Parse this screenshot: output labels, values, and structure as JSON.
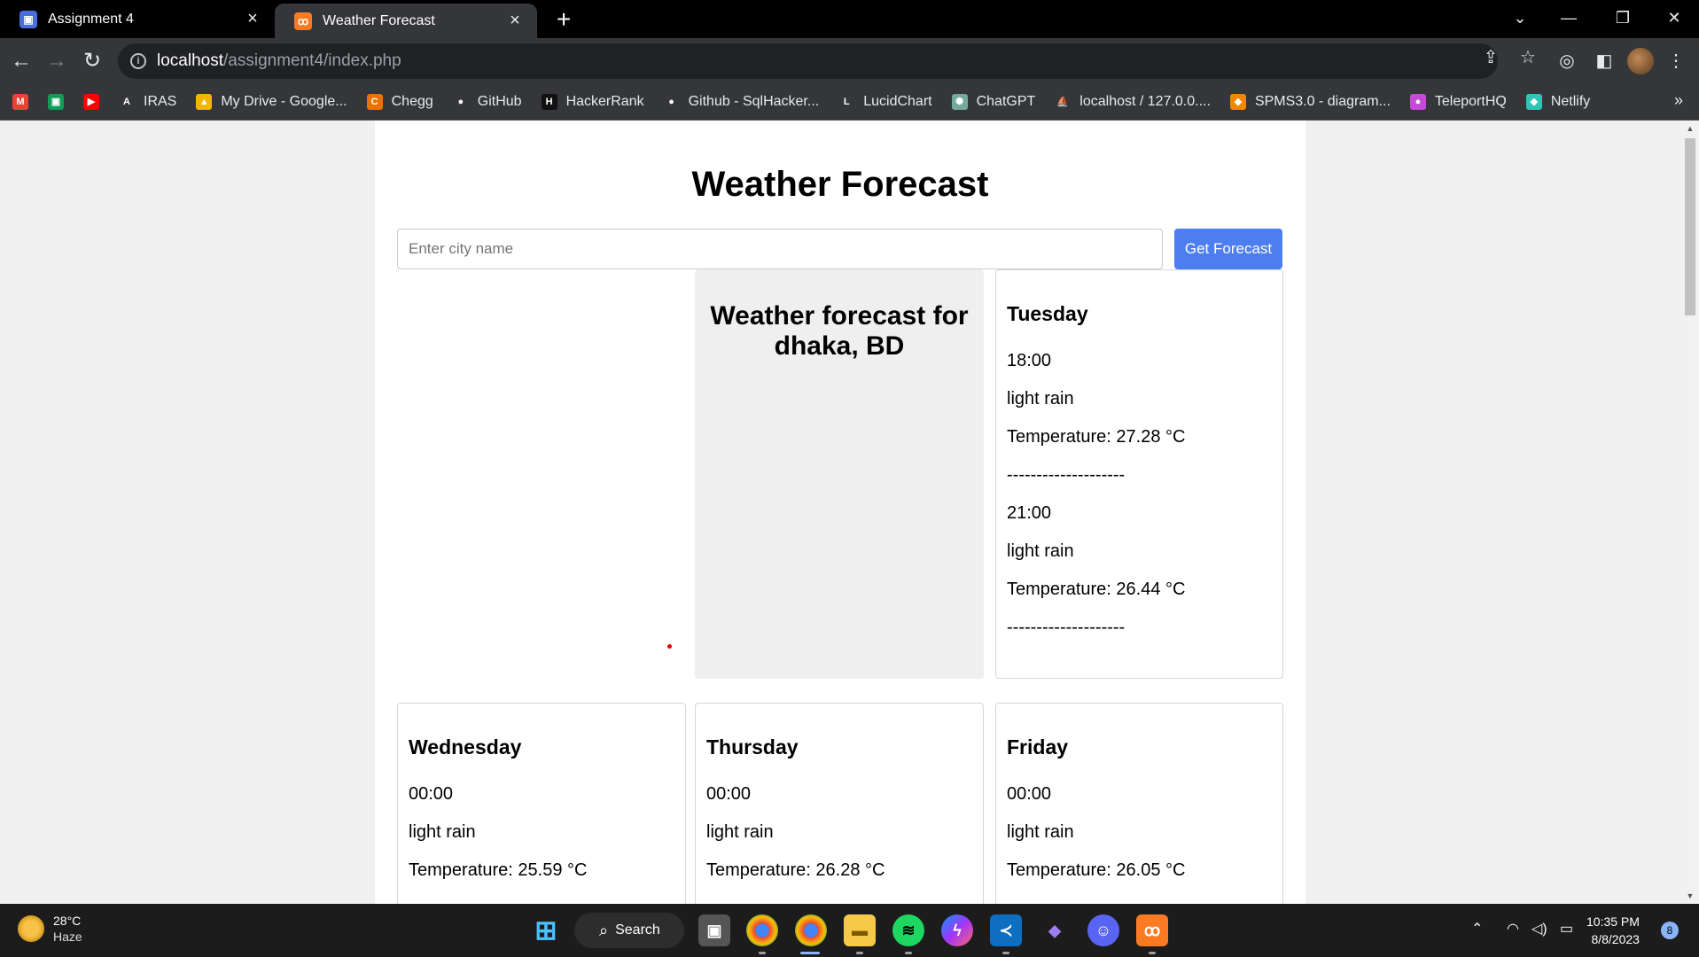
{
  "browser": {
    "tabs": [
      {
        "title": "Assignment 4",
        "favicon": "classroom-icon",
        "color": "#4a6ee0"
      },
      {
        "title": "Weather Forecast",
        "favicon": "xampp-icon",
        "color": "#fb7a24"
      }
    ],
    "new_tab": "+",
    "url_host": "localhost",
    "url_path": "/assignment4/index.php"
  },
  "bookmarks": [
    {
      "label": "",
      "icon": "gmail-icon",
      "color": "#ea4335",
      "glyph": "M"
    },
    {
      "label": "",
      "icon": "classroom-icon",
      "color": "#0f9d58",
      "glyph": "▣"
    },
    {
      "label": "",
      "icon": "youtube-icon",
      "color": "#ff0000",
      "glyph": "▶"
    },
    {
      "label": "IRAS",
      "icon": "iras-icon",
      "color": "#35363a",
      "glyph": "A"
    },
    {
      "label": "My Drive - Google...",
      "icon": "drive-icon",
      "color": "#f4b400",
      "glyph": "▲"
    },
    {
      "label": "Chegg",
      "icon": "chegg-icon",
      "color": "#eb7100",
      "glyph": "C"
    },
    {
      "label": "GitHub",
      "icon": "github-icon",
      "color": "#35363a",
      "glyph": "●"
    },
    {
      "label": "HackerRank",
      "icon": "hackerrank-icon",
      "color": "#111",
      "glyph": "H"
    },
    {
      "label": "Github - SqlHacker...",
      "icon": "github-icon",
      "color": "#35363a",
      "glyph": "●"
    },
    {
      "label": "LucidChart",
      "icon": "lucidchart-icon",
      "color": "#35363a",
      "glyph": "L"
    },
    {
      "label": "ChatGPT",
      "icon": "chatgpt-icon",
      "color": "#74aa9c",
      "glyph": "✺"
    },
    {
      "label": "localhost / 127.0.0....",
      "icon": "phpmyadmin-icon",
      "color": "#35363a",
      "glyph": "⛵"
    },
    {
      "label": "SPMS3.0 - diagram...",
      "icon": "drawio-icon",
      "color": "#f08705",
      "glyph": "◆"
    },
    {
      "label": "TeleportHQ",
      "icon": "teleporthq-icon",
      "color": "#c54ad8",
      "glyph": "●"
    },
    {
      "label": "Netlify",
      "icon": "netlify-icon",
      "color": "#32c3b5",
      "glyph": "◆"
    }
  ],
  "bookmarks_more": "»",
  "page": {
    "title": "Weather Forecast",
    "search_placeholder": "Enter city name",
    "button_label": "Get Forecast",
    "summary_title": "Weather forecast for dhaka, BD",
    "separator": "--------------------",
    "cards": [
      {
        "day": "Tuesday",
        "entries": [
          {
            "time": "18:00",
            "description": "light rain",
            "temperature": "Temperature: 27.28 °C"
          },
          {
            "time": "21:00",
            "description": "light rain",
            "temperature": "Temperature: 26.44 °C"
          }
        ]
      },
      {
        "day": "Wednesday",
        "entries": [
          {
            "time": "00:00",
            "description": "light rain",
            "temperature": "Temperature: 25.59 °C"
          }
        ]
      },
      {
        "day": "Thursday",
        "entries": [
          {
            "time": "00:00",
            "description": "light rain",
            "temperature": "Temperature: 26.28 °C"
          }
        ]
      },
      {
        "day": "Friday",
        "entries": [
          {
            "time": "00:00",
            "description": "light rain",
            "temperature": "Temperature: 26.05 °C"
          }
        ]
      }
    ]
  },
  "taskbar": {
    "weather_temp": "28°C",
    "weather_condition": "Haze",
    "search_label": "Search",
    "time": "10:35 PM",
    "date": "8/8/2023",
    "notification_count": "8"
  }
}
